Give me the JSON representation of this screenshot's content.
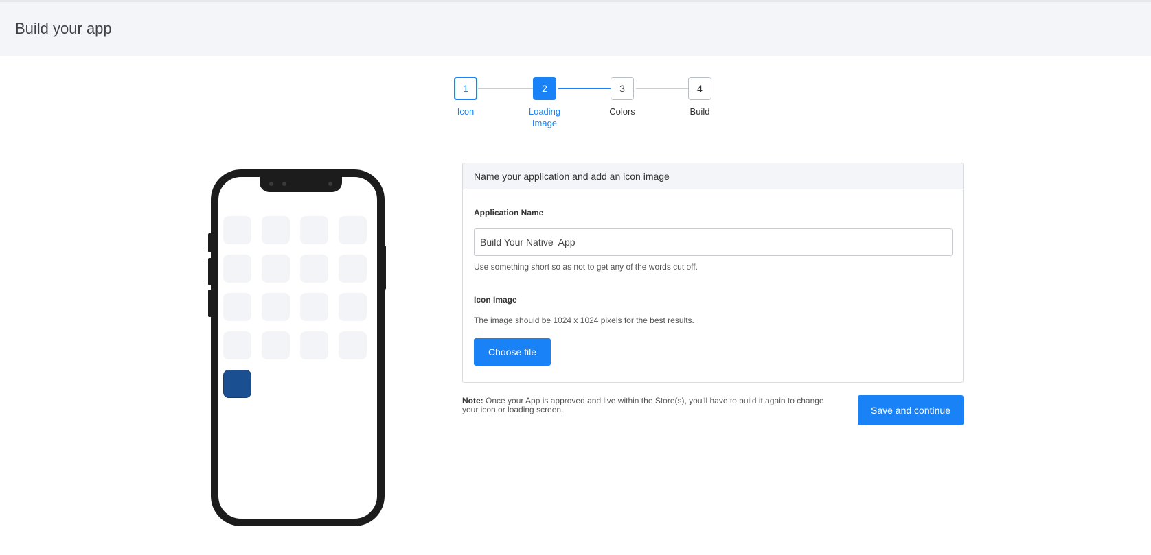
{
  "header": {
    "title": "Build your app"
  },
  "stepper": {
    "steps": [
      {
        "number": "1",
        "label": "Icon",
        "state": "done"
      },
      {
        "number": "2",
        "label": "Loading Image",
        "state": "current"
      },
      {
        "number": "3",
        "label": "Colors",
        "state": "upcoming"
      },
      {
        "number": "4",
        "label": "Build",
        "state": "upcoming"
      }
    ]
  },
  "card": {
    "header": "Name your application and add an icon image",
    "app_name_label": "Application Name",
    "app_name_value": "Build Your Native  App",
    "app_name_help": "Use something short so as not to get any of the words cut off.",
    "icon_label": "Icon Image",
    "icon_help": "The image should be 1024 x 1024 pixels for the best results.",
    "choose_file_label": "Choose file"
  },
  "note": {
    "prefix": "Note:",
    "text": " Once your App is approved and live within the Store(s), you'll have to build it again to change your icon or loading screen."
  },
  "save_label": "Save and continue",
  "colors": {
    "accent": "#1a82f7",
    "app_icon": "#1a4f91"
  }
}
